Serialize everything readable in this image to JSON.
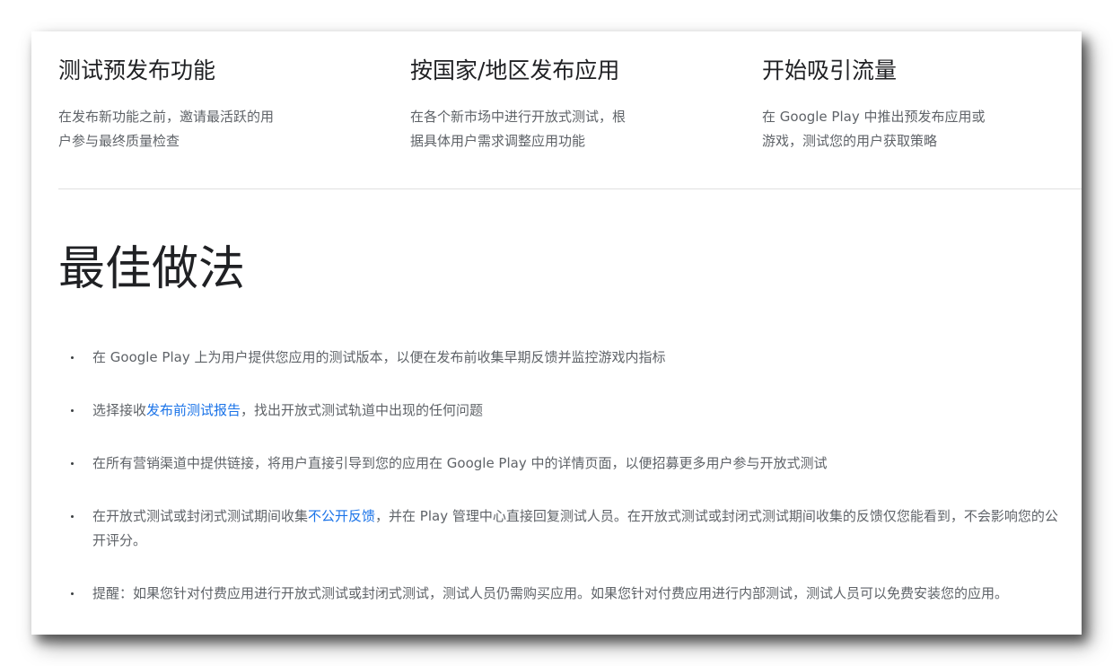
{
  "features": [
    {
      "title": "测试预发布功能",
      "desc_line1": "在发布新功能之前，邀请最活跃的用",
      "desc_line2": "户参与最终质量检查"
    },
    {
      "title": "按国家/地区发布应用",
      "desc_line1": "在各个新市场中进行开放式测试，根",
      "desc_line2": "据具体用户需求调整应用功能"
    },
    {
      "title": "开始吸引流量",
      "desc_line1": "在 Google Play 中推出预发布应用或",
      "desc_line2": "游戏，测试您的用户获取策略"
    }
  ],
  "section": {
    "title": "最佳做法"
  },
  "bullets": [
    {
      "text": "在 Google Play 上为用户提供您应用的测试版本，以便在发布前收集早期反馈并监控游戏内指标"
    },
    {
      "before": "选择接收",
      "link": "发布前测试报告",
      "after": "，找出开放式测试轨道中出现的任何问题"
    },
    {
      "text": "在所有营销渠道中提供链接，将用户直接引导到您的应用在 Google Play 中的详情页面，以便招募更多用户参与开放式测试"
    },
    {
      "before": "在开放式测试或封闭式测试期间收集",
      "link": "不公开反馈",
      "after": "，并在 Play 管理中心直接回复测试人员。在开放式测试或封闭式测试期间收集的反馈仅您能看到，不会影响您的公开评分。"
    },
    {
      "text": "提醒：如果您针对付费应用进行开放式测试或封闭式测试，测试人员仍需购买应用。如果您针对付费应用进行内部测试，测试人员可以免费安装您的应用。"
    }
  ],
  "colors": {
    "link": "#1a73e8",
    "heading": "#202124",
    "body_text": "#5f6368"
  }
}
